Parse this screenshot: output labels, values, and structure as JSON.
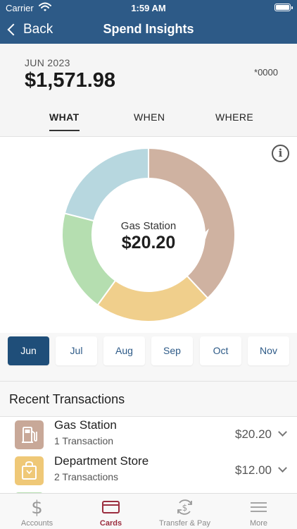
{
  "status_bar": {
    "carrier": "Carrier",
    "time": "1:59 AM"
  },
  "nav": {
    "back_label": "Back",
    "title": "Spend Insights"
  },
  "summary": {
    "period": "JUN 2023",
    "total": "$1,571.98",
    "account": "*0000"
  },
  "tabs": [
    {
      "label": "WHAT",
      "active": true
    },
    {
      "label": "WHEN",
      "active": false
    },
    {
      "label": "WHERE",
      "active": false
    }
  ],
  "chart_data": {
    "type": "pie",
    "donut": true,
    "segment_colors": [
      "#cfb2a1",
      "#f0cf8c",
      "#b5deb0",
      "#b7d7df"
    ],
    "segment_fractions": [
      0.38,
      0.22,
      0.19,
      0.21
    ],
    "center_label": "Gas Station",
    "center_value": "$20.20"
  },
  "months": [
    {
      "label": "Jun",
      "active": true
    },
    {
      "label": "Jul",
      "active": false
    },
    {
      "label": "Aug",
      "active": false
    },
    {
      "label": "Sep",
      "active": false
    },
    {
      "label": "Oct",
      "active": false
    },
    {
      "label": "Nov",
      "active": false
    }
  ],
  "recent": {
    "title": "Recent Transactions",
    "items": [
      {
        "name": "Gas Station",
        "count": "1 Transaction",
        "amount": "$20.20",
        "icon": "gas-pump-icon",
        "color": "#c8a898"
      },
      {
        "name": "Department Store",
        "count": "2 Transactions",
        "amount": "$12.00",
        "icon": "shopping-bag-icon",
        "color": "#efc877"
      },
      {
        "name": "",
        "count": "",
        "amount": "",
        "icon": "category-icon",
        "color": "#b5deb0"
      }
    ]
  },
  "tabbar": [
    {
      "label": "Accounts",
      "icon": "dollar-icon",
      "active": false
    },
    {
      "label": "Cards",
      "icon": "card-icon",
      "active": true
    },
    {
      "label": "Transfer & Pay",
      "icon": "transfer-icon",
      "active": false
    },
    {
      "label": "More",
      "icon": "menu-icon",
      "active": false
    }
  ],
  "colors": {
    "header": "#2d5a87",
    "accent": "#1f4e79",
    "active_tab": "#9b2d3e"
  }
}
